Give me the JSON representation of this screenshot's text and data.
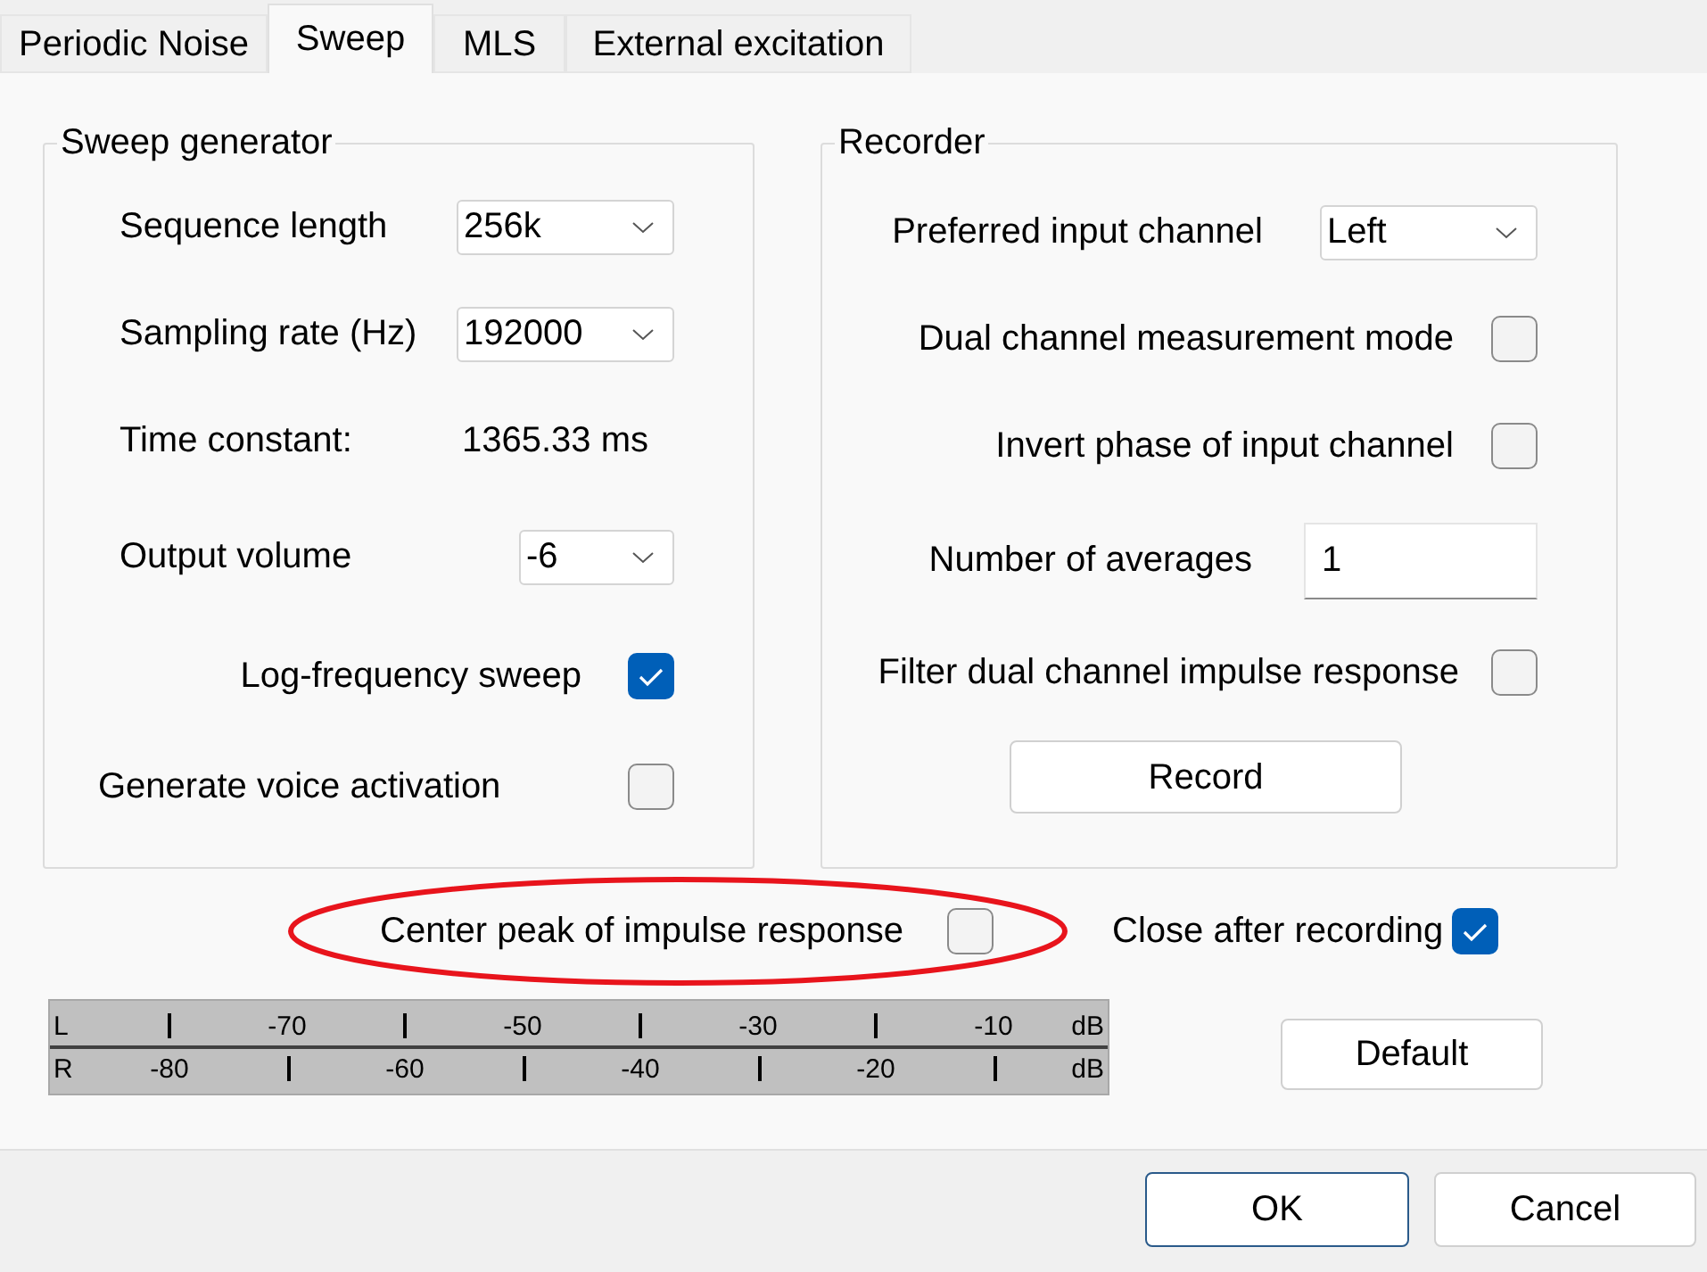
{
  "tabs": [
    {
      "label": "Periodic Noise",
      "selected": false
    },
    {
      "label": "Sweep",
      "selected": true
    },
    {
      "label": "MLS",
      "selected": false
    },
    {
      "label": "External excitation",
      "selected": false
    }
  ],
  "sweep_generator": {
    "title": "Sweep generator",
    "rows": [
      {
        "kind": "select",
        "label": "Sequence length",
        "value": "256k"
      },
      {
        "kind": "select",
        "label": "Sampling rate (Hz)",
        "value": "192000"
      },
      {
        "kind": "value",
        "label": "Time constant:",
        "value": "1365.33 ms"
      },
      {
        "kind": "select",
        "label": "Output volume",
        "value": "-6"
      },
      {
        "kind": "checkbox",
        "label": "Log-frequency sweep",
        "checked": true
      },
      {
        "kind": "checkbox",
        "label": "Generate voice activation",
        "checked": false
      }
    ]
  },
  "recorder": {
    "title": "Recorder",
    "rows": [
      {
        "kind": "select",
        "label": "Preferred input channel",
        "value": "Left"
      },
      {
        "kind": "checkbox",
        "label": "Dual channel measurement mode",
        "checked": false
      },
      {
        "kind": "checkbox",
        "label": "Invert phase of input channel",
        "checked": false
      },
      {
        "kind": "input",
        "label": "Number of averages",
        "value": "1"
      },
      {
        "kind": "checkbox",
        "label": "Filter dual channel impulse response",
        "checked": false
      }
    ],
    "record_button": "Record"
  },
  "center_peak": {
    "label": "Center peak of impulse response",
    "checked": false,
    "highlighted": true
  },
  "close_after_recording": {
    "label": "Close after recording",
    "checked": true
  },
  "meter": {
    "rows": [
      {
        "channel": "L",
        "labels": [
          "-70",
          "-50",
          "-30",
          "-10"
        ],
        "unit": "dB"
      },
      {
        "channel": "R",
        "labels": [
          "-80",
          "-60",
          "-40",
          "-20"
        ],
        "unit": "dB"
      }
    ]
  },
  "default_button": "Default",
  "buttons": [
    "OK",
    "Cancel"
  ]
}
